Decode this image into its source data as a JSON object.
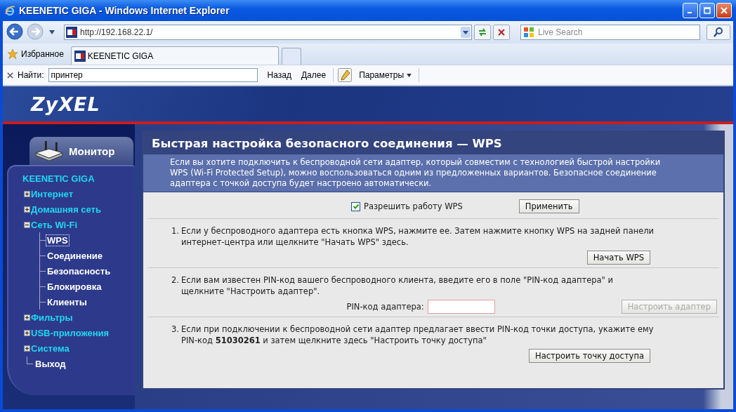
{
  "window": {
    "title": "KEENETIC GIGA - Windows Internet Explorer"
  },
  "browser": {
    "address": "http://192.168.22.1/",
    "search_placeholder": "Live Search",
    "favorites": "Избранное",
    "tabs": [
      {
        "label": "KEENETIC GIGA",
        "selected": true
      }
    ],
    "find_bar": {
      "label": "Найти:",
      "value": "принтер",
      "previous": "Назад",
      "next": "Далее",
      "options": "Параметры"
    }
  },
  "page": {
    "logo": "ZyXEL",
    "monitor_tab": "Монитор",
    "device": "KEENETIC GIGA",
    "menu": [
      {
        "label": "Интернет",
        "kind": "folder",
        "expanded": false
      },
      {
        "label": "Домашняя сеть",
        "kind": "folder",
        "expanded": false
      },
      {
        "label": "Сеть Wi-Fi",
        "kind": "folder",
        "expanded": true,
        "children": [
          {
            "label": "WPS",
            "selected": true
          },
          {
            "label": "Соединение",
            "selected": false
          },
          {
            "label": "Безопасность",
            "selected": false
          },
          {
            "label": "Блокировка",
            "selected": false
          },
          {
            "label": "Клиенты",
            "selected": false
          }
        ]
      },
      {
        "label": "Фильтры",
        "kind": "folder",
        "expanded": false
      },
      {
        "label": "USB-приложения",
        "kind": "folder",
        "expanded": false
      },
      {
        "label": "Система",
        "kind": "folder",
        "expanded": false
      },
      {
        "label": "Выход",
        "kind": "link"
      }
    ],
    "content": {
      "title": "Быстрая настройка безопасного соединения — WPS",
      "intro": "Если вы хотите подключить к беспроводной сети адаптер, который совместим с технологией быстрой настройки WPS (Wi-Fi Protected Setup), можно воспользоваться одним из предложенных вариантов. Безопасное соединение адаптера с точкой доступа будет настроено автоматически.",
      "enable_wps": {
        "label": "Разрешить работу WPS",
        "checked": true
      },
      "apply_button": "Применить",
      "steps": [
        {
          "number": "1.",
          "text": "Если у беспроводного адаптера есть кнопка WPS, нажмите ее. Затем нажмите кнопку WPS на задней панели интернет-центра или щелкните \"Начать WPS\" здесь.",
          "button": {
            "label": "Начать WPS",
            "disabled": false
          }
        },
        {
          "number": "2.",
          "text": "Если вам известен PIN-код вашего беспроводного клиента, введите его в поле \"PIN-код адаптера\" и щелкните \"Настроить адаптер\".",
          "field_label": "PIN-код адаптера:",
          "button": {
            "label": "Настроить адаптер",
            "disabled": true
          }
        },
        {
          "number": "3.",
          "text": "Если при подключении к беспроводной сети адаптер предлагает ввести PIN-код точки доступа, укажите ему PIN-код **51030261** и затем щелкните здесь \"Настроить точку доступа\"",
          "button": {
            "label": "Настроить точку доступа",
            "disabled": false
          }
        }
      ]
    }
  }
}
